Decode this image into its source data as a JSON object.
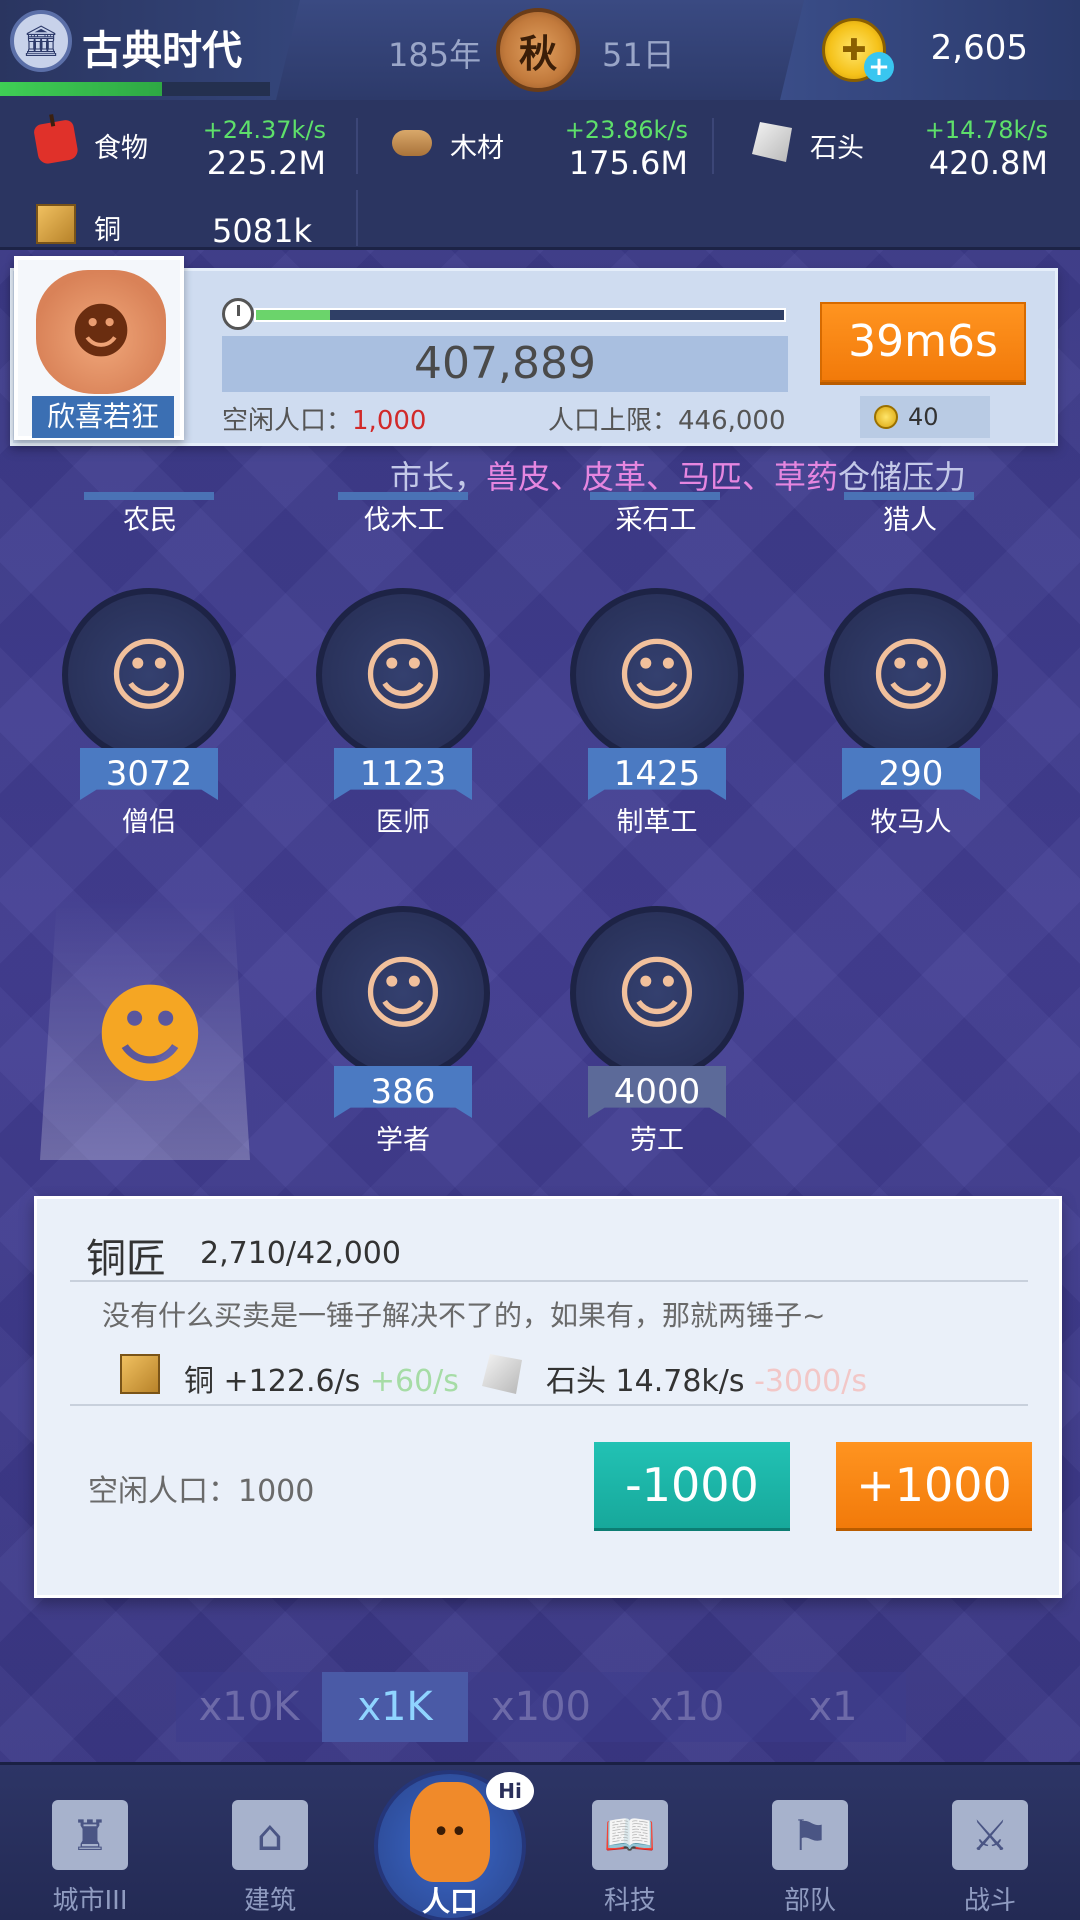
{
  "header": {
    "era_title": "古典时代",
    "era_progress": 0.6,
    "year": "185年",
    "season": "秋",
    "day": "51日",
    "gold_amount": "2,605",
    "gold_plus": "+"
  },
  "resources": [
    {
      "name": "食物",
      "rate": "+24.37k/s",
      "value": "225.2M",
      "icon": "food-icon"
    },
    {
      "name": "木材",
      "rate": "+23.86k/s",
      "value": "175.6M",
      "icon": "wood-icon"
    },
    {
      "name": "石头",
      "rate": "+14.78k/s",
      "value": "420.8M",
      "icon": "stone-icon"
    },
    {
      "name": "铜",
      "rate": "",
      "value": "5081k",
      "icon": "copper-icon"
    }
  ],
  "population": {
    "mayor_mood": "欣喜若狂",
    "progress": 0.14,
    "total": "407,889",
    "idle_label": "空闲人口：",
    "idle_value": "1,000",
    "cap_label": "人口上限：446,000",
    "timer": "39m6s",
    "timer_cost": "40"
  },
  "stress": {
    "prefix": "市长，",
    "items": "兽皮、皮革、马匹、草药",
    "suffix": "仓储压力"
  },
  "top_row": [
    "农民",
    "伐木工",
    "采石工",
    "猎人"
  ],
  "workers": [
    {
      "name": "僧侣",
      "count": "3072",
      "icon": "monk-icon"
    },
    {
      "name": "医师",
      "count": "1123",
      "icon": "doctor-icon"
    },
    {
      "name": "制革工",
      "count": "1425",
      "icon": "tanner-icon"
    },
    {
      "name": "牧马人",
      "count": "290",
      "icon": "horse-herder-icon"
    },
    {
      "name": "学者",
      "count": "386",
      "icon": "scholar-icon"
    },
    {
      "name": "劳工",
      "count": "4000",
      "icon": "laborer-icon"
    }
  ],
  "job_panel": {
    "title": "铜匠",
    "count": "2,710/42,000",
    "description": "没有什么买卖是一锤子解决不了的，如果有，那就两锤子~",
    "production": [
      {
        "resource": "铜",
        "value": "+122.6/s",
        "delta": "+60/s",
        "icon": "copper-icon"
      },
      {
        "resource": "石头",
        "value": "14.78k/s",
        "delta": "-3000/s",
        "icon": "stone-icon"
      }
    ],
    "idle": "空闲人口：1000",
    "minus_label": "-1000",
    "plus_label": "+1000"
  },
  "multipliers": {
    "options": [
      "x10K",
      "x1K",
      "x100",
      "x10",
      "x1"
    ],
    "selected": "x1K"
  },
  "bottom_nav": [
    {
      "label": "城市III",
      "icon": "castle-icon"
    },
    {
      "label": "建筑",
      "icon": "house-icon"
    },
    {
      "label": "人口",
      "icon": "population-icon",
      "badge": "Hi"
    },
    {
      "label": "科技",
      "icon": "book-icon"
    },
    {
      "label": "部队",
      "icon": "banner-icon"
    },
    {
      "label": "战斗",
      "icon": "swords-icon"
    }
  ]
}
